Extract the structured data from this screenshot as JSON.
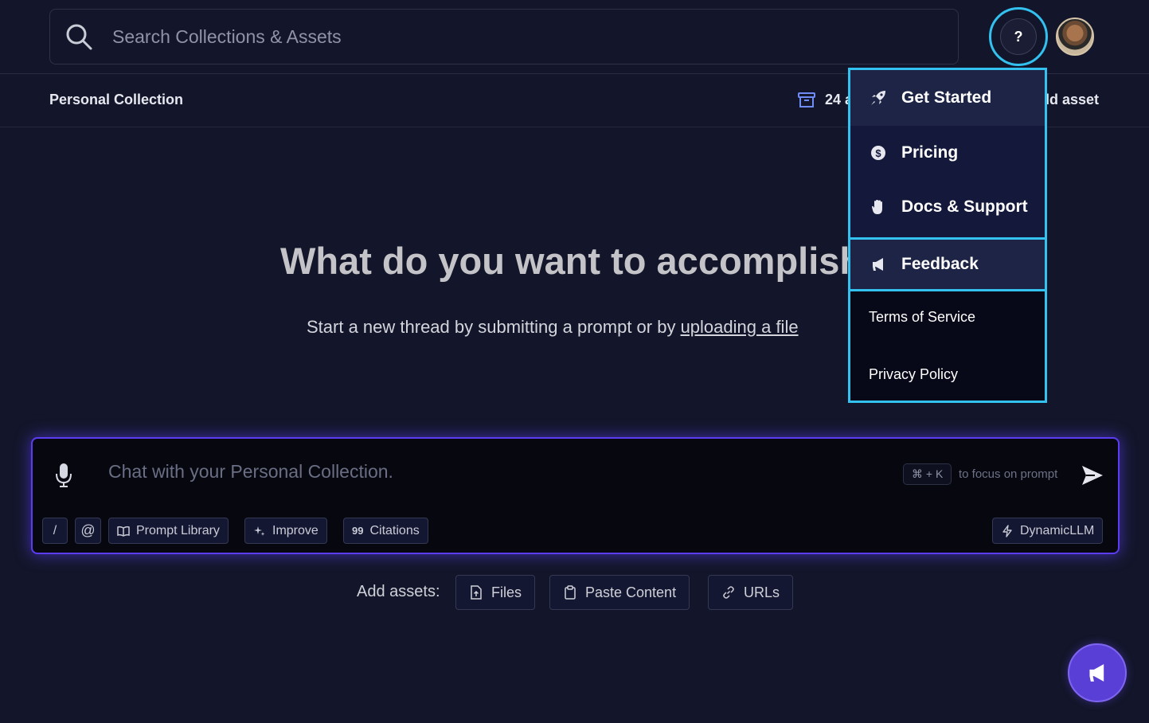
{
  "search": {
    "placeholder": "Search Collections & Assets"
  },
  "header": {
    "help_label": "?"
  },
  "collection": {
    "title": "Personal Collection",
    "asset_count": "24 a",
    "add_asset_label": "ld asset"
  },
  "hero": {
    "title": "What do you want to accomplish",
    "subtitle_prefix": "Start a new thread by submitting a prompt or by ",
    "subtitle_link": "uploading a file"
  },
  "chat": {
    "placeholder": "Chat with your Personal Collection.",
    "shortcut": "⌘ + K",
    "shortcut_hint": "to focus on prompt",
    "tools": {
      "slash": "/",
      "mention": "@",
      "prompt_library": "Prompt Library",
      "improve": "Improve",
      "citations": "Citations",
      "model": "DynamicLLM"
    }
  },
  "add_assets": {
    "label": "Add assets:",
    "files": "Files",
    "paste": "Paste Content",
    "urls": "URLs"
  },
  "help_menu": {
    "get_started": "Get Started",
    "pricing": "Pricing",
    "docs_support": "Docs & Support",
    "feedback": "Feedback",
    "terms": "Terms of Service",
    "privacy": "Privacy Policy"
  },
  "colors": {
    "background": "#13162a",
    "accent_cyan": "#33c1f0",
    "accent_purple": "#5b3cf0",
    "menu_bg": "#14183a"
  },
  "icons": [
    "search-icon",
    "archive-icon",
    "microphone-icon",
    "send-icon",
    "book-icon",
    "sparkle-icon",
    "quote-icon",
    "lightning-icon",
    "file-upload-icon",
    "clipboard-icon",
    "link-icon",
    "rocket-icon",
    "dollar-icon",
    "hand-icon",
    "megaphone-icon"
  ]
}
